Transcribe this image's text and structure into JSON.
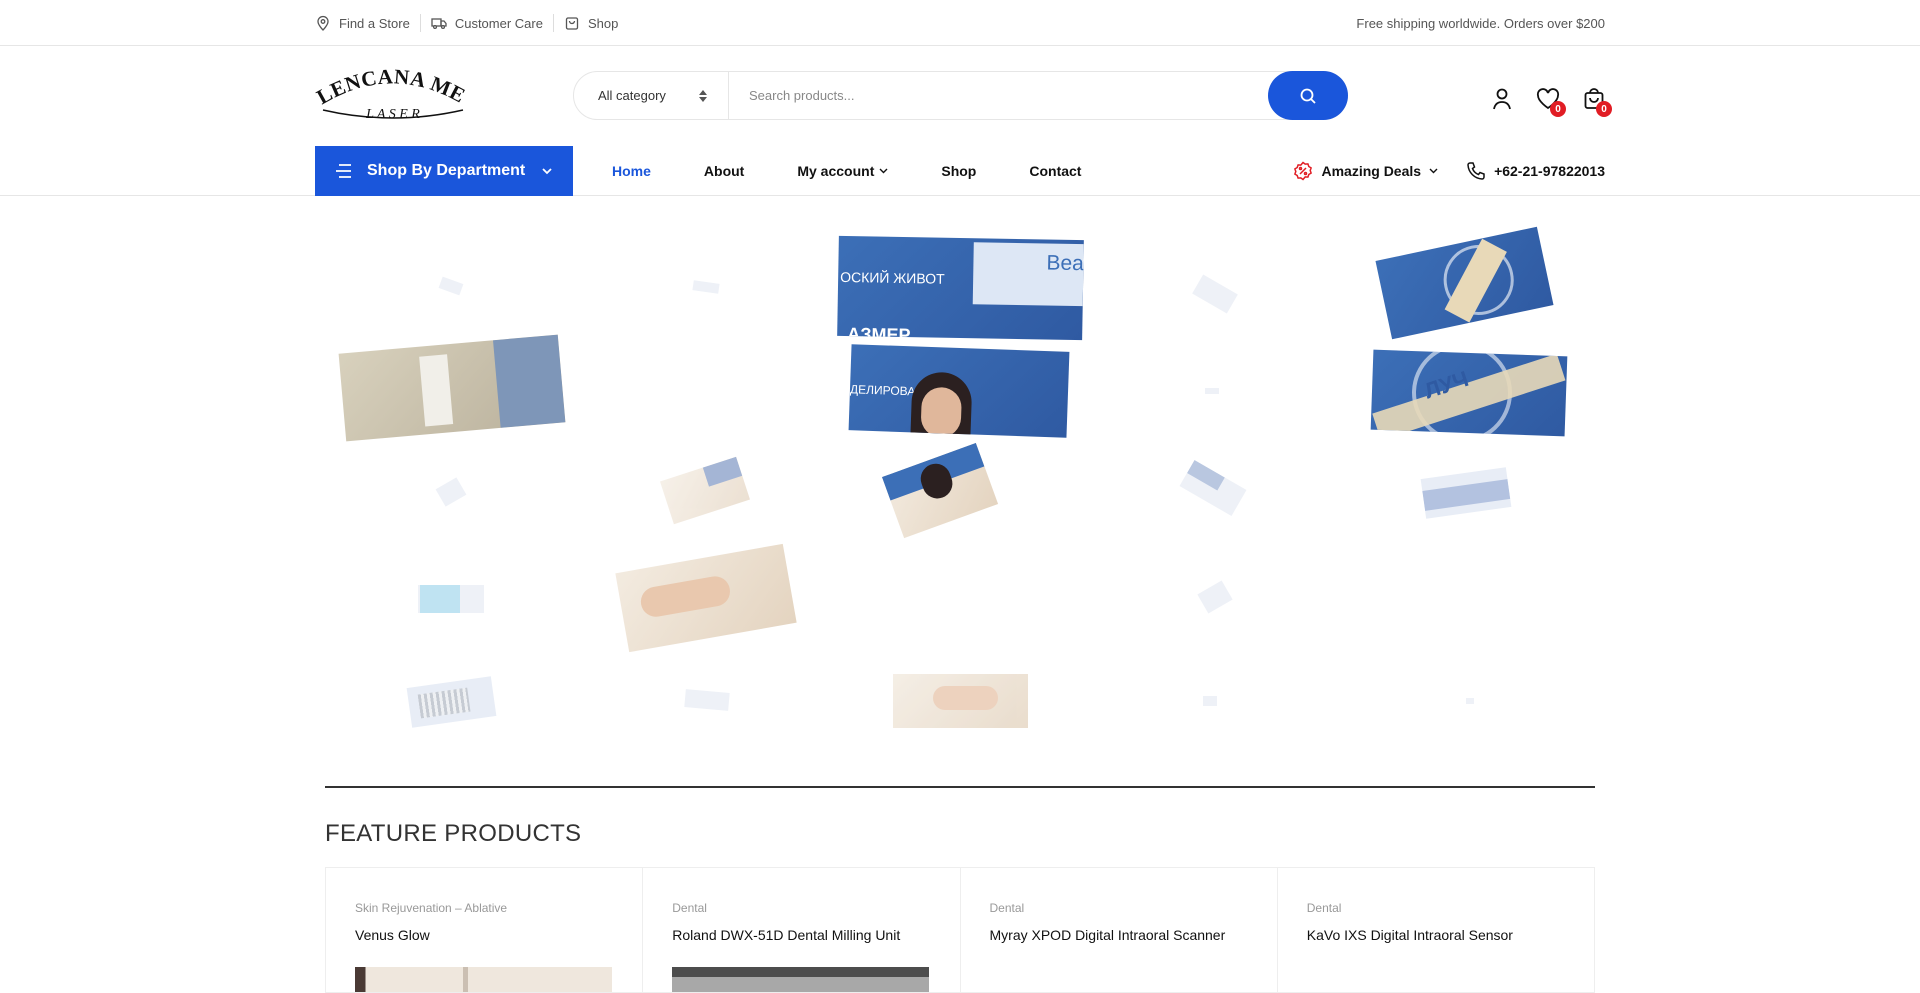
{
  "topbar": {
    "links": [
      {
        "label": "Find a Store",
        "icon": "map-pin-icon"
      },
      {
        "label": "Customer Care",
        "icon": "truck-icon"
      },
      {
        "label": "Shop",
        "icon": "shopping-bag-icon"
      }
    ],
    "promo": "Free shipping worldwide. Orders over $200"
  },
  "header": {
    "logo_text": "LENCANA MEDICAL",
    "logo_subtext": "L A S E R",
    "category_select": "All category",
    "search_placeholder": "Search products...",
    "wishlist_count": "0",
    "cart_count": "0"
  },
  "nav": {
    "department_label": "Shop By Department",
    "menu": [
      {
        "label": "Home",
        "active": true
      },
      {
        "label": "About"
      },
      {
        "label": "My account",
        "dropdown": true
      },
      {
        "label": "Shop"
      },
      {
        "label": "Contact"
      }
    ],
    "deals_label": "Amazing Deals",
    "phone": "+62-21-97822013"
  },
  "hero": {
    "banner_texts": {
      "russian_top": "ОСКИЙ ЖИВОТ",
      "russian_mid": "АЗМЕР",
      "russian_bottom": "ДЕЛИРОВА",
      "brand_partial": "Bea",
      "stamp_partial": "ЛУЧ"
    }
  },
  "section": {
    "title": "FEATURE PRODUCTS"
  },
  "products": [
    {
      "category": "Skin Rejuvenation – Ablative",
      "name": "Venus Glow"
    },
    {
      "category": "Dental",
      "name": "Roland DWX-51D Dental Milling Unit"
    },
    {
      "category": "Dental",
      "name": "Myray XPOD Digital Intraoral Scanner"
    },
    {
      "category": "Dental",
      "name": "KaVo IXS Digital Intraoral Sensor"
    }
  ],
  "colors": {
    "accent": "#1a56db",
    "badge": "#e11d24"
  }
}
